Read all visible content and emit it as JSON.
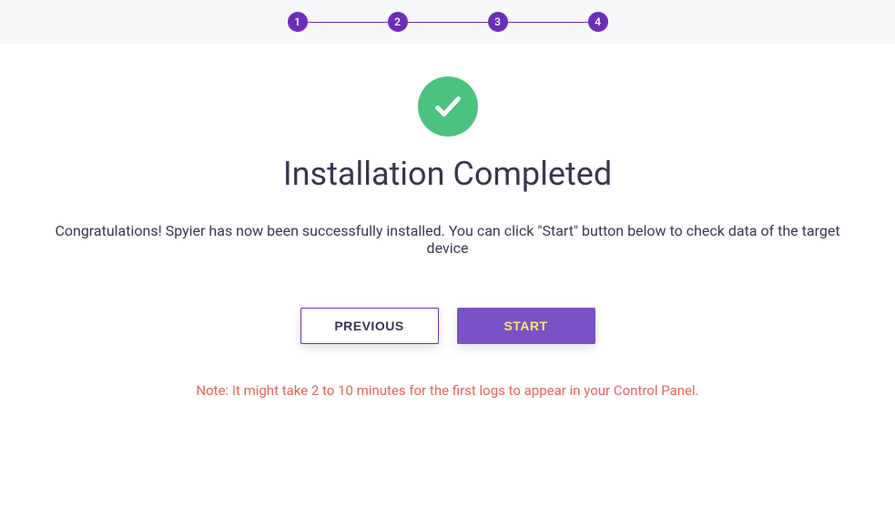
{
  "stepper": {
    "steps": [
      "1",
      "2",
      "3",
      "4"
    ]
  },
  "main": {
    "title": "Installation Completed",
    "description": "Congratulations! Spyier has now been successfully installed. You can click \"Start\" button below to check data of the target device",
    "note": "Note: It might take 2 to 10 minutes for the first logs to appear in your Control Panel."
  },
  "buttons": {
    "previous_label": "PREVIOUS",
    "start_label": "START"
  }
}
